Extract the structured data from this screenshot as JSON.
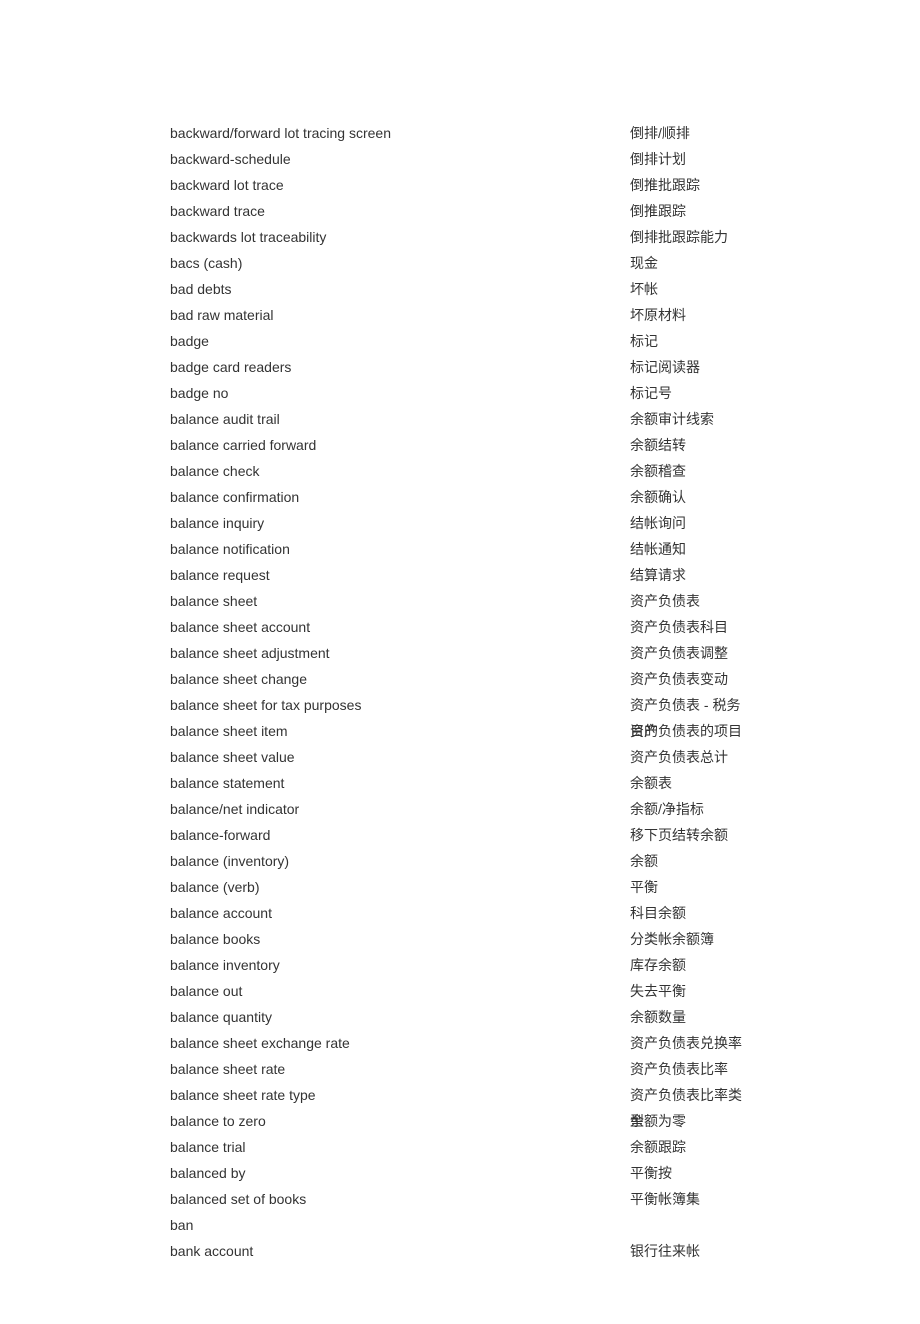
{
  "entries": [
    {
      "en": "backward/forward lot tracing screen",
      "zh": "倒排/顺排"
    },
    {
      "en": "backward-schedule",
      "zh": "倒排计划"
    },
    {
      "en": "backward lot trace",
      "zh": "倒推批跟踪"
    },
    {
      "en": "backward trace",
      "zh": "倒推跟踪"
    },
    {
      "en": "backwards lot traceability",
      "zh": "倒排批跟踪能力"
    },
    {
      "en": "bacs (cash)",
      "zh": "现金"
    },
    {
      "en": "bad debts",
      "zh": "坏帐"
    },
    {
      "en": "bad raw material",
      "zh": "坏原材料"
    },
    {
      "en": "badge",
      "zh": "标记"
    },
    {
      "en": "badge card readers",
      "zh": "标记阅读器"
    },
    {
      "en": "badge no",
      "zh": "标记号"
    },
    {
      "en": "balance audit trail",
      "zh": "余额审计线索"
    },
    {
      "en": "balance carried forward",
      "zh": "余额结转"
    },
    {
      "en": "balance check",
      "zh": "余额稽查"
    },
    {
      "en": "balance confirmation",
      "zh": "余额确认"
    },
    {
      "en": "balance inquiry",
      "zh": "结帐询问"
    },
    {
      "en": "balance notification",
      "zh": "结帐通知"
    },
    {
      "en": "balance request",
      "zh": "结算请求"
    },
    {
      "en": "balance sheet",
      "zh": "资产负债表"
    },
    {
      "en": "balance sheet account",
      "zh": "资产负债表科目"
    },
    {
      "en": "balance sheet adjustment",
      "zh": "资产负债表调整"
    },
    {
      "en": "balance sheet change",
      "zh": "资产负债表变动"
    },
    {
      "en": "balance sheet for tax purposes",
      "zh": "资产负债表 - 税务目的"
    },
    {
      "en": "balance sheet item",
      "zh": "资产负债表的项目"
    },
    {
      "en": "balance sheet value",
      "zh": "资产负债表总计"
    },
    {
      "en": "balance statement",
      "zh": "余额表"
    },
    {
      "en": "balance/net indicator",
      "zh": "余额/净指标"
    },
    {
      "en": "balance-forward",
      "zh": "移下页结转余额"
    },
    {
      "en": "balance (inventory)",
      "zh": "余额"
    },
    {
      "en": "balance (verb)",
      "zh": "平衡"
    },
    {
      "en": "balance account",
      "zh": "科目余额"
    },
    {
      "en": "balance books",
      "zh": "分类帐余额簿"
    },
    {
      "en": "balance inventory",
      "zh": "库存余额"
    },
    {
      "en": "balance out",
      "zh": "失去平衡"
    },
    {
      "en": "balance quantity",
      "zh": "余额数量"
    },
    {
      "en": "balance sheet exchange rate",
      "zh": "资产负债表兑换率"
    },
    {
      "en": "balance sheet rate",
      "zh": "资产负债表比率"
    },
    {
      "en": "balance sheet rate type",
      "zh": "资产负债表比率类型"
    },
    {
      "en": "balance to zero",
      "zh": "余额为零"
    },
    {
      "en": "balance trial",
      "zh": "余额跟踪"
    },
    {
      "en": "balanced by",
      "zh": "平衡按"
    },
    {
      "en": "balanced set of books",
      "zh": "平衡帐簿集"
    },
    {
      "en": "ban",
      "zh": ""
    },
    {
      "en": "bank account",
      "zh": "银行往来帐"
    }
  ]
}
